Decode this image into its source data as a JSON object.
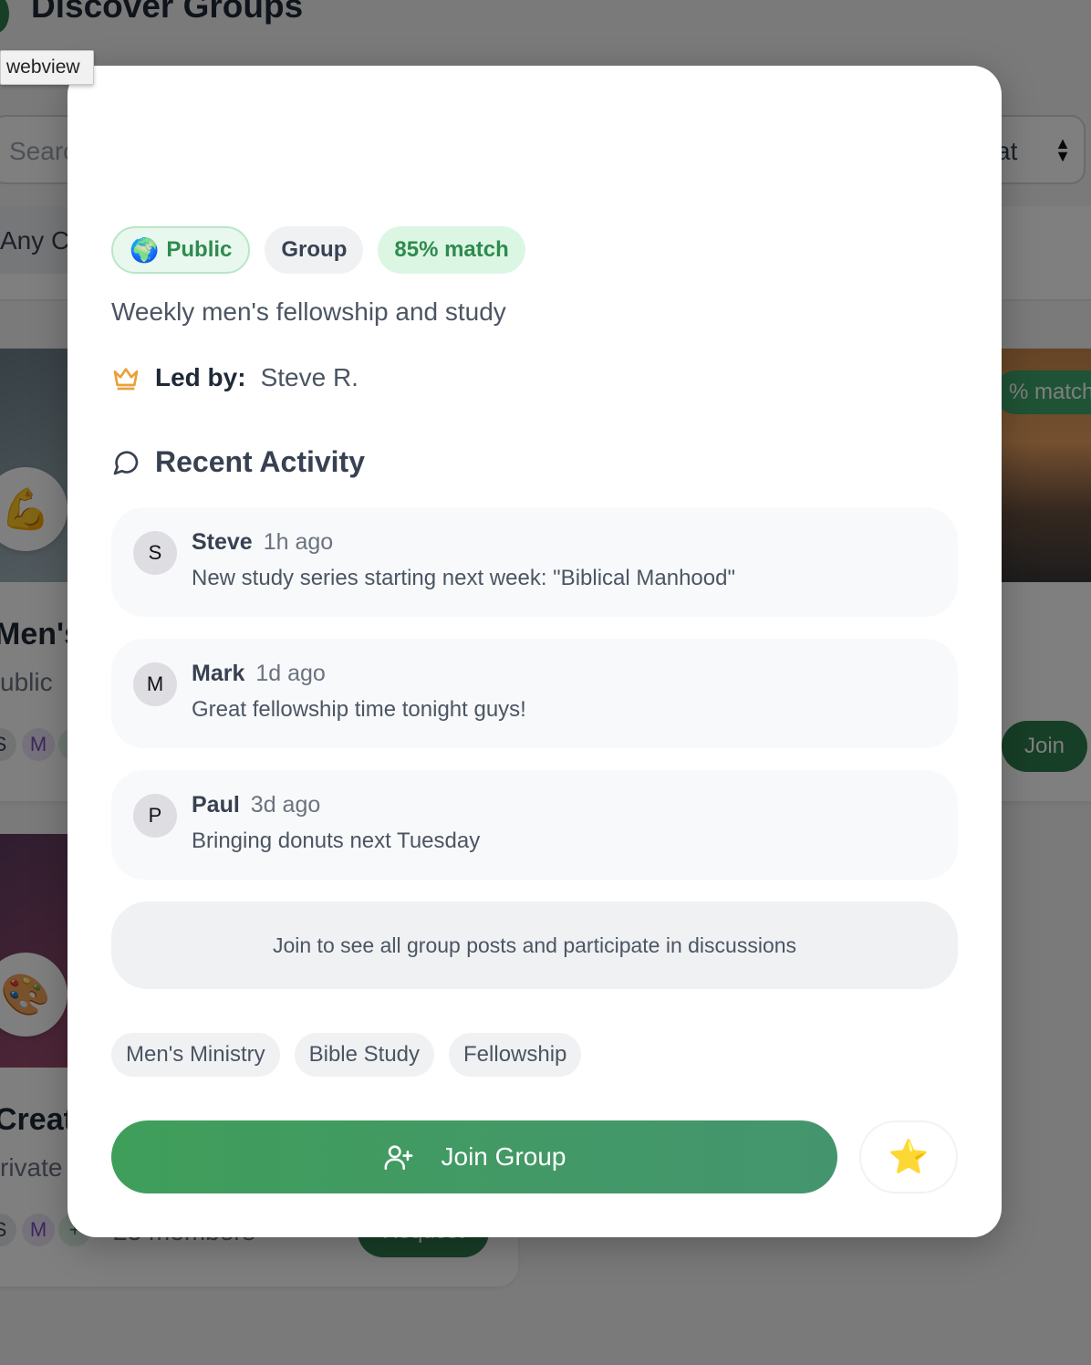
{
  "background": {
    "page_title": "Discover Groups",
    "search_placeholder": "Search",
    "select_value": "at",
    "filter_label": "Any C",
    "cards": [
      {
        "emoji": "💪",
        "title": "Men's",
        "privacy": "ublic",
        "members_text": "",
        "avatars": [
          "S",
          "M",
          ""
        ]
      },
      {
        "emoji": "🎨",
        "title": "Creati",
        "privacy": "rivate",
        "members_text": "23 members",
        "avatars": [
          "S",
          "M",
          "+"
        ],
        "button": "Request"
      }
    ],
    "right_card": {
      "match": "% match",
      "button": "Join"
    }
  },
  "tooltip": "webview",
  "modal": {
    "badges": {
      "public_icon": "🌍",
      "public": "Public",
      "type": "Group",
      "match": "85% match"
    },
    "description": "Weekly men's fellowship and study",
    "leader": {
      "icon": "crown-icon",
      "label": "Led by:",
      "name": "Steve R."
    },
    "activity": {
      "icon": "chat-bubble-icon",
      "title": "Recent Activity",
      "posts": [
        {
          "initial": "S",
          "author": "Steve",
          "time": "1h ago",
          "text": "New study series starting next week: \"Biblical Manhood\""
        },
        {
          "initial": "M",
          "author": "Mark",
          "time": "1d ago",
          "text": "Great fellowship time tonight guys!"
        },
        {
          "initial": "P",
          "author": "Paul",
          "time": "3d ago",
          "text": "Bringing donuts next Tuesday"
        }
      ]
    },
    "join_note": "Join to see all group posts and participate in discussions",
    "tags": [
      "Men's Ministry",
      "Bible Study",
      "Fellowship"
    ],
    "join_button": {
      "icon": "user-plus-icon",
      "label": "Join Group"
    },
    "favorite_button": {
      "icon": "⭐"
    }
  },
  "colors": {
    "accent": "#3f9e5a",
    "match_bg": "#dcf6e4",
    "overlay": "rgba(0,0,0,0.5)"
  }
}
